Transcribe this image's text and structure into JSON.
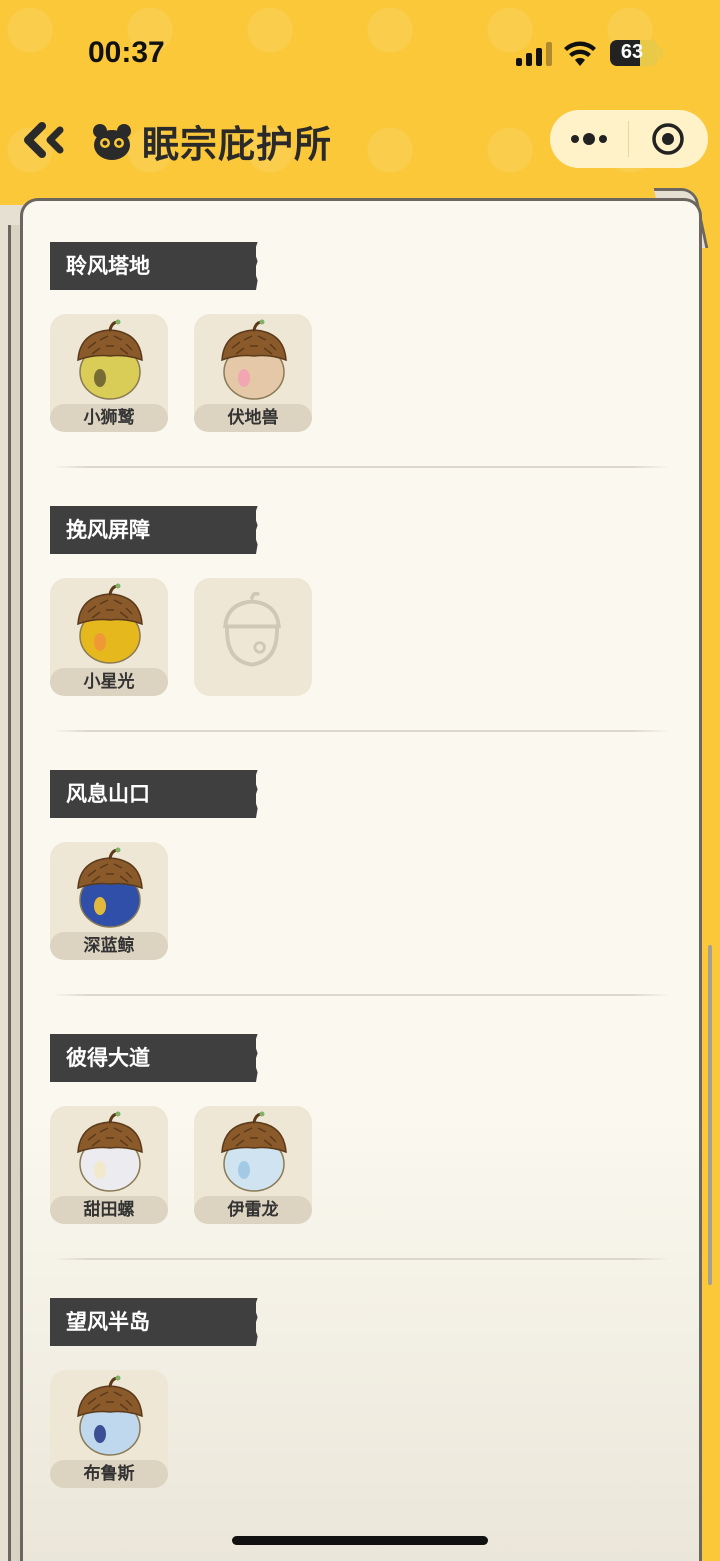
{
  "status_bar": {
    "time": "00:37",
    "battery": "63"
  },
  "header": {
    "title": "眠宗庇护所"
  },
  "sections": [
    {
      "title": "聆风塔地",
      "pets": [
        {
          "name": "小狮鹫",
          "body_color": "#D9CC57",
          "accent": "#6B6230"
        },
        {
          "name": "伏地兽",
          "body_color": "#E4C8A8",
          "accent": "#F2A2B3"
        }
      ]
    },
    {
      "title": "挽风屏障",
      "pets": [
        {
          "name": "小星光",
          "body_color": "#E5B81E",
          "accent": "#F29538"
        },
        {
          "name": "",
          "empty": true
        }
      ]
    },
    {
      "title": "风息山口",
      "pets": [
        {
          "name": "深蓝鲸",
          "body_color": "#2F4FA8",
          "accent": "#F5C531"
        }
      ]
    },
    {
      "title": "彼得大道",
      "pets": [
        {
          "name": "甜田螺",
          "body_color": "#ECECF0",
          "accent": "#F3E9C8"
        },
        {
          "name": "伊雷龙",
          "body_color": "#CFE3F0",
          "accent": "#9CC7E6"
        }
      ]
    },
    {
      "title": "望风半岛",
      "pets": [
        {
          "name": "布鲁斯",
          "body_color": "#BFD8EE",
          "accent": "#2D3F8A"
        }
      ]
    }
  ]
}
